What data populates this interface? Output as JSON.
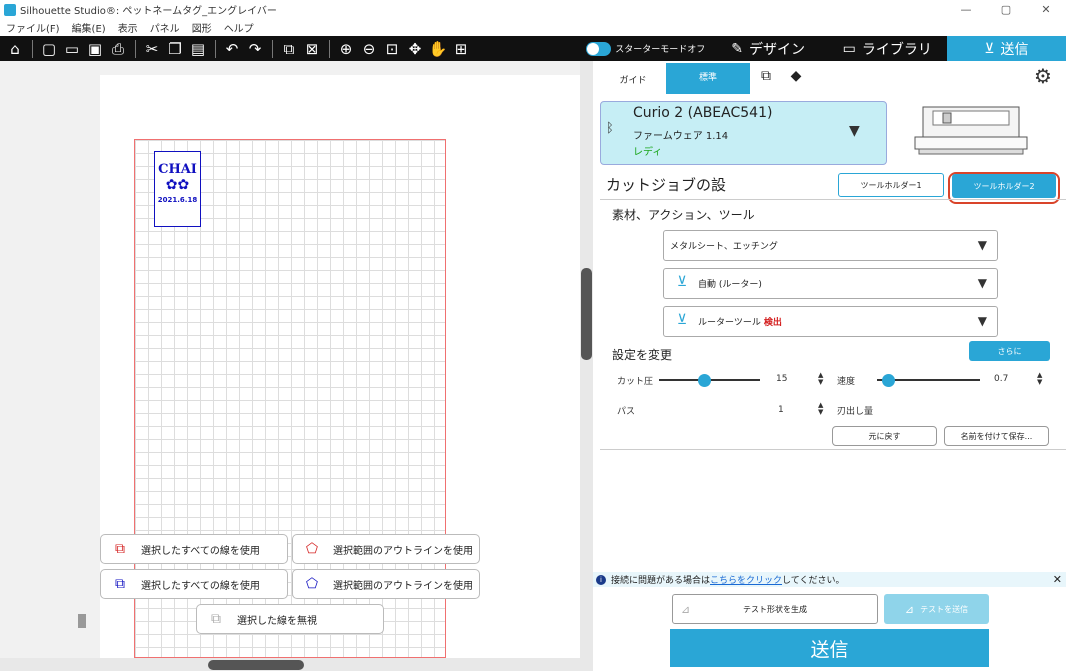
{
  "window": {
    "title": "Silhouette Studio®: ペットネームタグ_エングレイバー",
    "minimize": "—",
    "restore": "▢",
    "close": "✕"
  },
  "menu": [
    "ファイル(F)",
    "編集(E)",
    "表示",
    "パネル",
    "図形",
    "ヘルプ"
  ],
  "toolbar_icons": [
    "home-icon",
    "new-file-icon",
    "open-folder-icon",
    "save-icon",
    "print-icon",
    "cut-icon",
    "copy-icon",
    "paste-icon",
    "undo-icon",
    "redo-icon",
    "group-icon",
    "ungroup-icon",
    "zoom-in-icon",
    "zoom-out-icon",
    "zoom-fit-icon",
    "pan-icon",
    "hand-icon",
    "fit-page-icon"
  ],
  "mode": {
    "starter_label": "スターターモードオフ",
    "design": "デザイン",
    "library": "ライブラリ",
    "send": "送信"
  },
  "tag": {
    "name": "CHAI",
    "paws": "✿✿",
    "date": "2021.6.18"
  },
  "line_buttons": {
    "red_all": "選択したすべての線を使用",
    "red_outline": "選択範囲のアウトラインを使用",
    "blue_all": "選択したすべての線を使用",
    "blue_outline": "選択範囲のアウトラインを使用",
    "ignore": "選択した線を無視"
  },
  "panel_tabs": {
    "guide": "ガイド",
    "standard": "標準"
  },
  "device": {
    "name": "Curio 2 (ABEAC541)",
    "firmware": "ファームウェア 1.14",
    "status": "レディ"
  },
  "job": {
    "title": "カットジョブの設",
    "holder1": "ツールホルダー1",
    "holder2": "ツールホルダー2"
  },
  "material": {
    "title": "素材、アクション、ツール",
    "material": "メタルシート、エッチング",
    "action": "自動 (ルーター)",
    "tool_prefix": "ルーターツール",
    "tool_status": "検出"
  },
  "settings": {
    "title": "設定を変更",
    "more": "さらに",
    "pressure_label": "カット圧",
    "pressure": "15",
    "speed_label": "速度",
    "speed": "0.7",
    "passes_label": "パス",
    "passes": "1",
    "blade_label": "刃出し量",
    "reset": "元に戻す",
    "save_as": "名前を付けて保存..."
  },
  "info": {
    "prefix": "接続に問題がある場合は",
    "link": "こちらをクリック",
    "suffix": "してください。"
  },
  "bottom": {
    "test_gen": "テスト形状を生成",
    "test_send": "テストを送信",
    "send": "送信"
  },
  "colors": {
    "accent": "#2aa6d6",
    "highlight": "#d9442a",
    "ready": "#1aa51a"
  }
}
